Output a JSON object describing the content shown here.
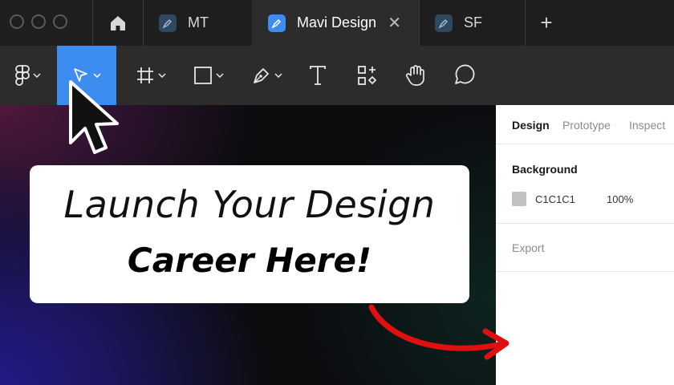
{
  "tabs": {
    "items": [
      {
        "label": "MT"
      },
      {
        "label": "Mavi Design"
      },
      {
        "label": "SF"
      }
    ],
    "close_glyph": "✕",
    "new_tab_glyph": "+"
  },
  "toolbar": {
    "tools": [
      "figma-menu",
      "move-tool",
      "frame-tool",
      "rectangle-tool",
      "pen-tool",
      "text-tool",
      "resources-tool",
      "hand-tool",
      "comment-tool"
    ],
    "active_tool": "move-tool",
    "accent": "#3d8df0"
  },
  "canvas": {
    "headline_line1": "Launch Your Design",
    "headline_line2": "Career Here!"
  },
  "panel": {
    "tabs": [
      "Design",
      "Prototype",
      "Inspect"
    ],
    "background_title": "Background",
    "fill_hex": "C1C1C1",
    "fill_opacity": "100%",
    "fill_color": "#c1c1c1",
    "export_title": "Export"
  },
  "colors": {
    "arrow": "#e01010",
    "titlebar": "#1e1e1e",
    "toolbar": "#2c2c2c"
  }
}
